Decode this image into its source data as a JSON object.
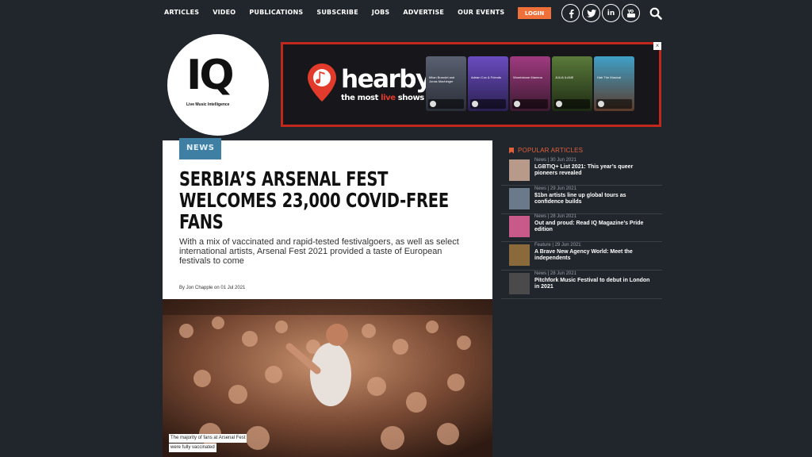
{
  "nav": {
    "items": [
      "ARTICLES",
      "VIDEO",
      "PUBLICATIONS",
      "SUBSCRIBE",
      "JOBS",
      "ADVERTISE",
      "OUR EVENTS"
    ],
    "login_label": "LOGIN",
    "social_icons": [
      "facebook-icon",
      "twitter-icon",
      "linkedin-icon",
      "youtube-icon"
    ],
    "search_icon": "search-icon"
  },
  "logo": {
    "mark": "IQ",
    "tagline": "Live Music Intelligence"
  },
  "ad": {
    "brand": "hearby",
    "slogan_pre": "the most ",
    "slogan_hl": "live",
    "slogan_post": " shows",
    "tiles": [
      {
        "title": "Milan Brandel and Jonas Machinger",
        "color": "#3c4250"
      },
      {
        "title": "Adrian Cox & Friends",
        "color": "#4a3c8c"
      },
      {
        "title": "Wombstone Mamma",
        "color": "#6b2d5a"
      },
      {
        "title": "JULIA ILANE",
        "color": "#3d5a2a"
      },
      {
        "title": "Hair The Musical",
        "color": "#7a4a2a"
      }
    ],
    "close": "×"
  },
  "article": {
    "category": "NEWS",
    "headline_l1": "SERBIA’S ARSENAL FEST",
    "headline_l2": "WELCOMES 23,000 COVID-FREE",
    "headline_l3": "FANS",
    "standfirst": "With a mix of vaccinated and rapid-tested festivalgoers, as well as select international artists, Arsenal Fest 2021 provided a taste of European festivals to come",
    "byline": "By Jon Chapple on 01 Jul 2021",
    "caption_l1": "The majority of fans at Arsenal Fest",
    "caption_l2": "were fully vaccinated"
  },
  "popular": {
    "title": "POPULAR ARTICLES",
    "items": [
      {
        "meta": "News | 30 Jun 2021",
        "title": "LGBTIQ+ List 2021: This year’s queer pioneers revealed",
        "thumb": "#b89a8a"
      },
      {
        "meta": "News | 29 Jun 2021",
        "title": "$1bn artists line up global tours as confidence builds",
        "thumb": "#6a7a8a"
      },
      {
        "meta": "News | 28 Jun 2021",
        "title": "Out and proud: Read IQ Magazine’s Pride edition",
        "thumb": "#c85a8a"
      },
      {
        "meta": "Feature | 29 Jun 2021",
        "title": "A Brave New Agency World: Meet the independents",
        "thumb": "#8a6a3a"
      },
      {
        "meta": "News | 28 Jun 2021",
        "title": "Pitchfork Music Festival to debut in London in 2021",
        "thumb": "#4a4a4a"
      }
    ]
  },
  "colors": {
    "background": "#21252c",
    "accent": "#f0703a",
    "news_tag": "#3f7fa3",
    "ad_border": "#c0271d"
  }
}
